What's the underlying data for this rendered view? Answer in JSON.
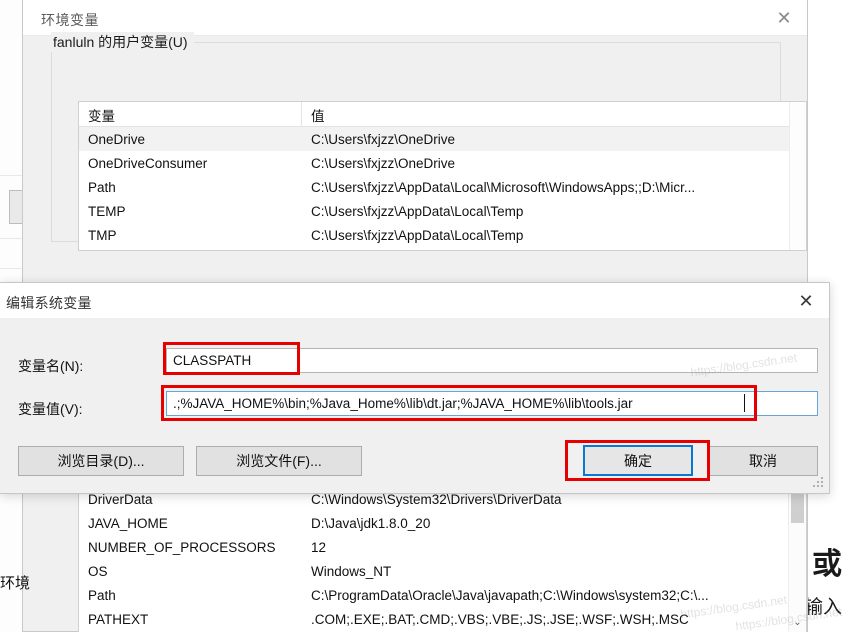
{
  "colors": {
    "annotation_red": "#e60000",
    "focus_blue": "#0a78d0",
    "window_bg": "#f0f0f0",
    "list_bg": "#ffffff"
  },
  "background": {
    "left_fragment_text": "环境",
    "right_fragment_big": "或",
    "right_fragment_small": "输入"
  },
  "env_window": {
    "title": "环境变量",
    "close_icon": "close-icon",
    "close_glyph": "✕",
    "user_group_label": "fanluln 的用户变量(U)",
    "columns": {
      "name": "变量",
      "value": "值"
    },
    "user_variables": [
      {
        "name": "OneDrive",
        "value": "C:\\Users\\fxjzz\\OneDrive",
        "selected": true
      },
      {
        "name": "OneDriveConsumer",
        "value": "C:\\Users\\fxjzz\\OneDrive",
        "selected": false
      },
      {
        "name": "Path",
        "value": "C:\\Users\\fxjzz\\AppData\\Local\\Microsoft\\WindowsApps;;D:\\Micr...",
        "selected": false
      },
      {
        "name": "TEMP",
        "value": "C:\\Users\\fxjzz\\AppData\\Local\\Temp",
        "selected": false
      },
      {
        "name": "TMP",
        "value": "C:\\Users\\fxjzz\\AppData\\Local\\Temp",
        "selected": false
      }
    ],
    "system_variables": [
      {
        "name": "DriverData",
        "value": "C:\\Windows\\System32\\Drivers\\DriverData"
      },
      {
        "name": "JAVA_HOME",
        "value": "D:\\Java\\jdk1.8.0_20"
      },
      {
        "name": "NUMBER_OF_PROCESSORS",
        "value": "12"
      },
      {
        "name": "OS",
        "value": "Windows_NT"
      },
      {
        "name": "Path",
        "value": "C:\\ProgramData\\Oracle\\Java\\javapath;C:\\Windows\\system32;C:\\..."
      },
      {
        "name": "PATHEXT",
        "value": ".COM;.EXE;.BAT;.CMD;.VBS;.VBE;.JS;.JSE;.WSF;.WSH;.MSC"
      }
    ],
    "scroll_down_glyph": "⌄"
  },
  "edit_dialog": {
    "title": "编辑系统变量",
    "close_glyph": "✕",
    "name_label": "变量名(N):",
    "name_value": "CLASSPATH",
    "value_label": "变量值(V):",
    "value_value": ".;%JAVA_HOME%\\bin;%Java_Home%\\lib\\dt.jar;%JAVA_HOME%\\lib\\tools.jar",
    "browse_dir_label": "浏览目录(D)...",
    "browse_file_label": "浏览文件(F)...",
    "ok_label": "确定",
    "cancel_label": "取消"
  },
  "watermark": {
    "text": "https://blog.csdn.net"
  }
}
